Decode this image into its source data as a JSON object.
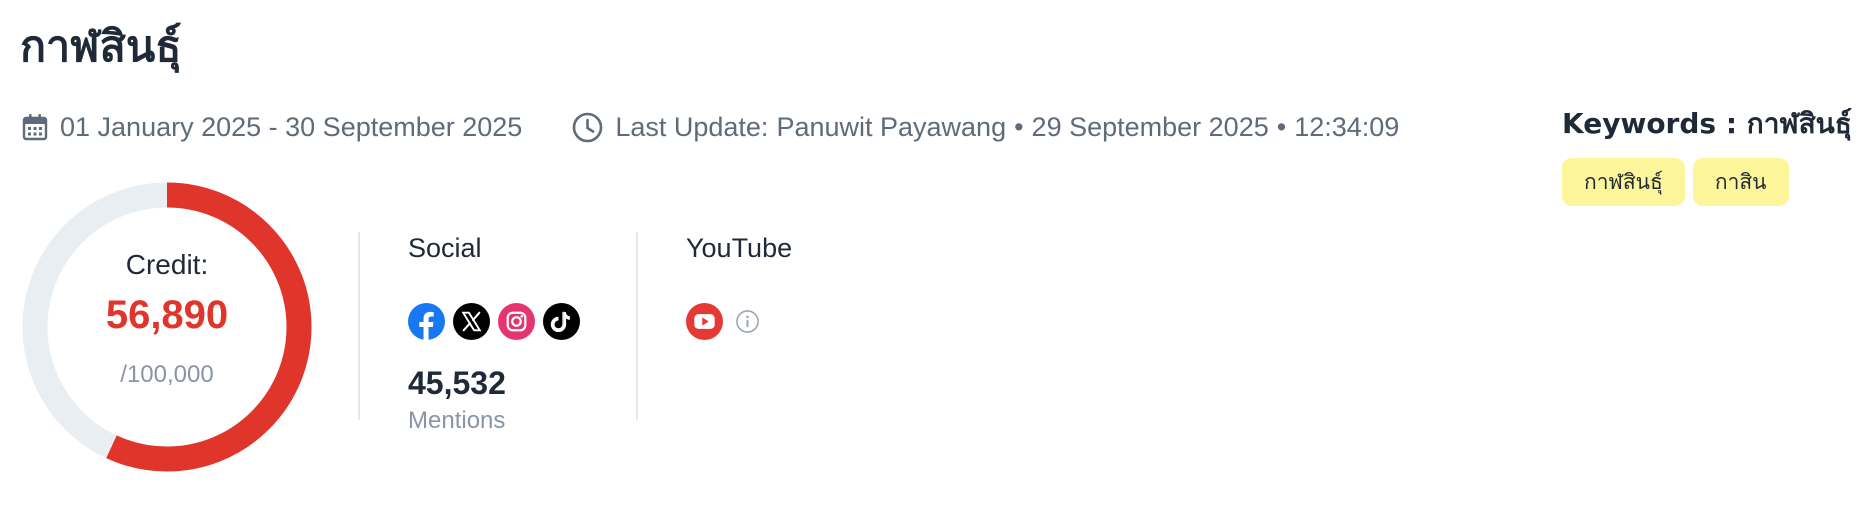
{
  "page": {
    "title": "กาฬสินธุ์"
  },
  "meta": {
    "date_range": "01 January 2025 - 30 September 2025",
    "last_update_label": "Last Update:",
    "last_update_user": "Panuwit Payawang",
    "last_update_date": "29 September 2025",
    "last_update_time": "12:34:09",
    "separator": "•"
  },
  "keywords": {
    "title": "Keywords : กาฬสินธุ์",
    "tags": [
      "กาฬสินธุ์",
      "กาสิน"
    ],
    "tag_color": "#fdf59a"
  },
  "credit": {
    "label": "Credit:",
    "used": 56890,
    "used_display": "56,890",
    "total_display": "/100,000",
    "total": 100000,
    "used_color": "#e0352b",
    "track_color": "#e9eef3"
  },
  "social": {
    "title": "Social",
    "icons": [
      "facebook-icon",
      "x-icon",
      "instagram-icon",
      "tiktok-icon"
    ],
    "mentions_value": "45,532",
    "mentions_label": "Mentions"
  },
  "youtube": {
    "title": "YouTube",
    "icons": [
      "youtube-icon",
      "info-icon"
    ]
  }
}
